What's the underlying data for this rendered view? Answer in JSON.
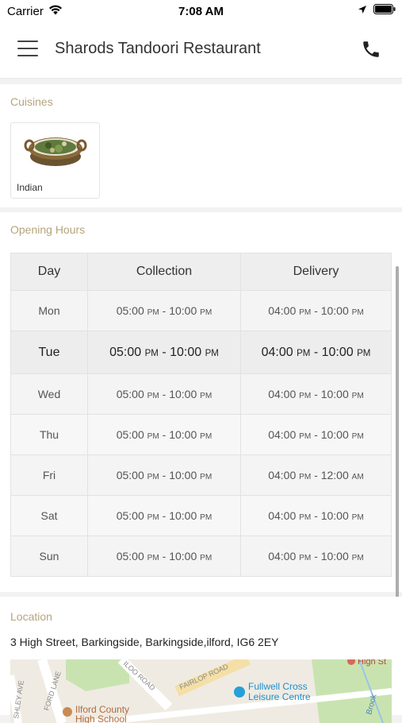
{
  "status_bar": {
    "carrier": "Carrier",
    "time": "7:08 AM"
  },
  "header": {
    "title": "Sharods Tandoori Restaurant"
  },
  "cuisines": {
    "title": "Cuisines",
    "items": [
      {
        "label": "Indian"
      }
    ]
  },
  "opening_hours": {
    "title": "Opening Hours",
    "columns": [
      "Day",
      "Collection",
      "Delivery"
    ],
    "rows": [
      {
        "day": "Mon",
        "c_open": "05:00",
        "c_open_ap": "PM",
        "c_close": "10:00",
        "c_close_ap": "PM",
        "d_open": "04:00",
        "d_open_ap": "PM",
        "d_close": "10:00",
        "d_close_ap": "PM"
      },
      {
        "day": "Tue",
        "c_open": "05:00",
        "c_open_ap": "PM",
        "c_close": "10:00",
        "c_close_ap": "PM",
        "d_open": "04:00",
        "d_open_ap": "PM",
        "d_close": "10:00",
        "d_close_ap": "PM"
      },
      {
        "day": "Wed",
        "c_open": "05:00",
        "c_open_ap": "PM",
        "c_close": "10:00",
        "c_close_ap": "PM",
        "d_open": "04:00",
        "d_open_ap": "PM",
        "d_close": "10:00",
        "d_close_ap": "PM"
      },
      {
        "day": "Thu",
        "c_open": "05:00",
        "c_open_ap": "PM",
        "c_close": "10:00",
        "c_close_ap": "PM",
        "d_open": "04:00",
        "d_open_ap": "PM",
        "d_close": "10:00",
        "d_close_ap": "PM"
      },
      {
        "day": "Fri",
        "c_open": "05:00",
        "c_open_ap": "PM",
        "c_close": "10:00",
        "c_close_ap": "PM",
        "d_open": "04:00",
        "d_open_ap": "PM",
        "d_close": "12:00",
        "d_close_ap": "AM"
      },
      {
        "day": "Sat",
        "c_open": "05:00",
        "c_open_ap": "PM",
        "c_close": "10:00",
        "c_close_ap": "PM",
        "d_open": "04:00",
        "d_open_ap": "PM",
        "d_close": "10:00",
        "d_close_ap": "PM"
      },
      {
        "day": "Sun",
        "c_open": "05:00",
        "c_open_ap": "PM",
        "c_close": "10:00",
        "c_close_ap": "PM",
        "d_open": "04:00",
        "d_open_ap": "PM",
        "d_close": "10:00",
        "d_close_ap": "PM"
      }
    ]
  },
  "location": {
    "title": "Location",
    "address": "3 High Street, Barkingside, Barkingside,ilford, IG6 2EY",
    "map_labels": {
      "fullwell": "Fullwell Cross",
      "leisure": "Leisure Centre",
      "ilford_county": "Ilford County",
      "high_school": "High School",
      "high_st": "High St",
      "fairlop": "FAIRLOP ROAD",
      "iloo": "ILOO ROAD",
      "ford_lane": "FORD LANE",
      "shley": "SHLEY AVE",
      "brook": "Brook"
    }
  },
  "colors": {
    "section_title": "#b5a47c",
    "accent_map_marker": "#27a0d7"
  }
}
